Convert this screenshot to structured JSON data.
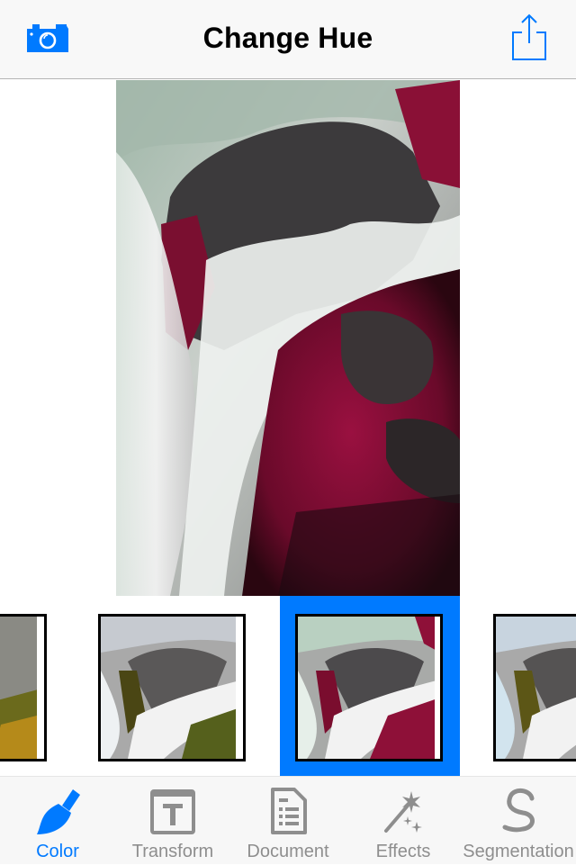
{
  "navbar": {
    "title": "Change Hue",
    "left_icon": "camera-icon",
    "right_icon": "share-icon"
  },
  "main_image": {
    "description": "Waterfall over rocks with hue shifted to crimson/magenta"
  },
  "filter_strip": {
    "thumbnails": [
      {
        "name": "hue-variant-1",
        "tint": "yellow-green",
        "selected": false
      },
      {
        "name": "hue-variant-2",
        "tint": "olive",
        "selected": false
      },
      {
        "name": "hue-variant-3",
        "tint": "crimson",
        "selected": true
      },
      {
        "name": "hue-variant-4",
        "tint": "olive-blue",
        "selected": false
      }
    ]
  },
  "tabbar": {
    "active": "Color",
    "items": [
      {
        "label": "Color",
        "icon": "paintbrush-icon"
      },
      {
        "label": "Transform",
        "icon": "text-box-icon"
      },
      {
        "label": "Document",
        "icon": "document-icon"
      },
      {
        "label": "Effects",
        "icon": "magic-wand-icon"
      },
      {
        "label": "Segmentation",
        "icon": "segmentation-curve-icon"
      }
    ]
  },
  "colors": {
    "accent": "#007aff",
    "inactive": "#8e8e8e",
    "navbar_bg": "#f8f8f8"
  }
}
